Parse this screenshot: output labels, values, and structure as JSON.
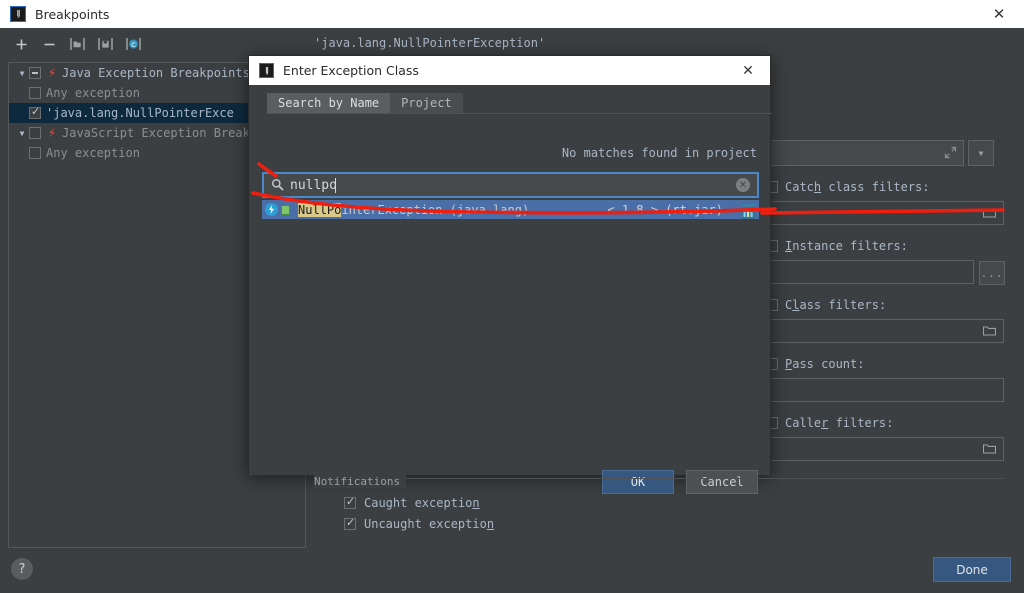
{
  "window": {
    "title": "Breakpoints",
    "logo_text": "IJ",
    "close_icon": "✕"
  },
  "toolbar": {
    "items": [
      {
        "name": "add-breakpoint-button",
        "glyph": "+"
      },
      {
        "name": "remove-breakpoint-button",
        "glyph": "−"
      },
      {
        "name": "move-to-group-icon",
        "glyph": "▣"
      },
      {
        "name": "edit-description-icon",
        "glyph": "▤"
      },
      {
        "name": "mute-breakpoints-icon",
        "glyph": "◉"
      }
    ]
  },
  "tree": {
    "nodes": [
      {
        "label": "Java Exception Breakpoints",
        "expander": "▼",
        "checkbox": "partial",
        "bolt": true,
        "indent": false,
        "selected": false
      },
      {
        "label": "Any exception",
        "expander": "",
        "checkbox": "unchecked",
        "bolt": false,
        "indent": true,
        "selected": false
      },
      {
        "label": "'java.lang.NullPointerExce",
        "expander": "",
        "checkbox": "checked",
        "bolt": false,
        "indent": true,
        "selected": true
      },
      {
        "label": "JavaScript Exception Breakp",
        "expander": "▼",
        "checkbox": "unchecked",
        "bolt": true,
        "indent": false,
        "selected": false
      },
      {
        "label": "Any exception",
        "expander": "",
        "checkbox": "unchecked",
        "bolt": false,
        "indent": true,
        "selected": false
      }
    ]
  },
  "details": {
    "exception_header": "'java.lang.NullPointerException'",
    "condition_value": "",
    "expand_icon": "⤢",
    "dropdown_icon": "▼",
    "fields": [
      {
        "name": "catch-class-filters",
        "label_pre": "Catc",
        "label_key": "h",
        "label_post": " class filters:",
        "value": "",
        "trailing": "folder"
      },
      {
        "name": "instance-filters",
        "label_pre": "",
        "label_key": "I",
        "label_post": "nstance filters:",
        "value": "",
        "trailing": "ellipsis"
      },
      {
        "name": "class-filters",
        "label_pre": "C",
        "label_key": "l",
        "label_post": "ass filters:",
        "value": "",
        "trailing": "folder"
      },
      {
        "name": "pass-count",
        "label_pre": "",
        "label_key": "P",
        "label_post": "ass count:",
        "value": "",
        "trailing": "none"
      },
      {
        "name": "caller-filters",
        "label_pre": "Calle",
        "label_key": "r",
        "label_post": " filters:",
        "value": "",
        "trailing": "folder"
      }
    ],
    "folder_icon": "🗀",
    "ellipsis_label": "..."
  },
  "notifications": {
    "section_title": "Notifications",
    "items": [
      {
        "label": "Caught exception",
        "checked": true
      },
      {
        "label": "Uncaught exception",
        "checked": true
      }
    ]
  },
  "footer": {
    "help_label": "?",
    "done_label": "Done"
  },
  "dialog": {
    "title": "Enter Exception Class",
    "logo_text": "IJ",
    "close_icon": "✕",
    "tabs": [
      {
        "label": "Search by Name",
        "active": true
      },
      {
        "label": "Project",
        "active": false
      }
    ],
    "status_text": "No matches found in project",
    "search": {
      "value": "nullpo",
      "placeholder": "",
      "search_icon": "⌕",
      "clear_icon": "✕"
    },
    "result": {
      "highlight": "NullPo",
      "rest": "interException (java.lang)",
      "version": "< 1.8 > (rt.jar)",
      "class_icon": "⚡",
      "lock_icon": "lock-icon",
      "library_icon": "library-icon"
    },
    "buttons": {
      "ok": "OK",
      "cancel": "Cancel"
    }
  },
  "colors": {
    "accent_blue": "#365880",
    "selection_blue": "#4a6fa8",
    "tree_selection": "#0d293e",
    "highlight_yellow": "#d8c98a",
    "annotation_red": "#f01e0e",
    "panel_bg": "#3c3f41",
    "text": "#a9b7c6"
  }
}
